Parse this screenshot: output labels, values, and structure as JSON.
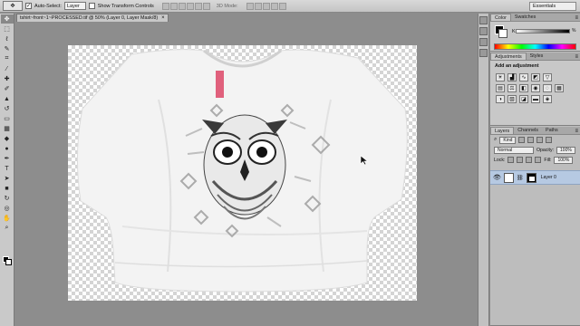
{
  "options_bar": {
    "auto_select_label": "Auto-Select:",
    "auto_select_checked": true,
    "auto_select_target": "Layer",
    "show_transform_label": "Show Transform Controls",
    "show_transform_checked": false,
    "mode_3d_label": "3D Mode:",
    "workspace": "Essentials"
  },
  "document": {
    "tab_title": "tshirt~front~1~PROCESSED.tif @ 50% (Layer 0, Layer Mask/8)"
  },
  "tools": [
    {
      "name": "move-tool",
      "glyph": "✥"
    },
    {
      "name": "marquee-tool",
      "glyph": "⬚"
    },
    {
      "name": "lasso-tool",
      "glyph": "ℓ"
    },
    {
      "name": "quick-select-tool",
      "glyph": "✎"
    },
    {
      "name": "crop-tool",
      "glyph": "⌗"
    },
    {
      "name": "eyedropper-tool",
      "glyph": "⁄"
    },
    {
      "name": "healing-tool",
      "glyph": "✚"
    },
    {
      "name": "brush-tool",
      "glyph": "✐"
    },
    {
      "name": "clone-stamp-tool",
      "glyph": "▲"
    },
    {
      "name": "history-brush-tool",
      "glyph": "↺"
    },
    {
      "name": "eraser-tool",
      "glyph": "▭"
    },
    {
      "name": "gradient-tool",
      "glyph": "▦"
    },
    {
      "name": "blur-tool",
      "glyph": "◆"
    },
    {
      "name": "dodge-tool",
      "glyph": "●"
    },
    {
      "name": "pen-tool",
      "glyph": "✒"
    },
    {
      "name": "type-tool",
      "glyph": "T"
    },
    {
      "name": "path-select-tool",
      "glyph": "➤"
    },
    {
      "name": "shape-tool",
      "glyph": "■"
    },
    {
      "name": "3d-rotate-tool",
      "glyph": "↻"
    },
    {
      "name": "3d-camera-tool",
      "glyph": "◎"
    },
    {
      "name": "hand-tool",
      "glyph": "✋"
    },
    {
      "name": "zoom-tool",
      "glyph": "⌕"
    }
  ],
  "color_panel": {
    "tabs": [
      "Color",
      "Swatches"
    ],
    "channel_label": "K",
    "channel_value": "%"
  },
  "adjustments_panel": {
    "tabs": [
      "Adjustments",
      "Styles"
    ],
    "hint": "Add an adjustment"
  },
  "layers_panel": {
    "tabs": [
      "Layers",
      "Channels",
      "Paths"
    ],
    "filter_label": "Kind",
    "blend_mode": "Normal",
    "opacity_label": "Opacity:",
    "opacity_value": "100%",
    "lock_label": "Lock:",
    "fill_label": "Fill:",
    "fill_value": "100%",
    "layers": [
      {
        "name": "Layer 0",
        "visible": true,
        "selected": true,
        "has_mask": true
      }
    ]
  }
}
